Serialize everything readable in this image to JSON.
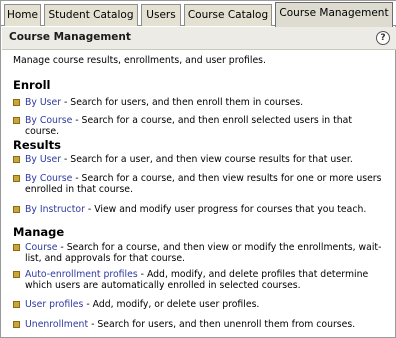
{
  "tabs": [
    {
      "label": "Home"
    },
    {
      "label": "Student Catalog"
    },
    {
      "label": "Users"
    },
    {
      "label": "Course Catalog"
    },
    {
      "label": "Course Management"
    }
  ],
  "header": {
    "title": "Course Management",
    "help": "?"
  },
  "intro": "Manage course results, enrollments, and user profiles.",
  "sections": {
    "enroll": {
      "title": "Enroll",
      "items": [
        {
          "link": "By User",
          "desc": " - Search for users, and then enroll them in courses."
        },
        {
          "link": "By Course",
          "desc": " - Search for a course, and then enroll selected users in that course."
        }
      ]
    },
    "results": {
      "title": "Results",
      "items": [
        {
          "link": "By User",
          "desc": " - Search for a user, and then view course results for that user."
        },
        {
          "link": "By Course",
          "desc": " - Search for a course, and then view results for one or more users enrolled in that course."
        },
        {
          "link": "By Instructor",
          "desc": " - View and modify user progress for courses that you teach."
        }
      ]
    },
    "manage": {
      "title": "Manage",
      "items": [
        {
          "link": "Course",
          "desc": " - Search for a course, and then view or modify the enrollments, wait-list, and approvals for that course."
        },
        {
          "link": "Auto-enrollment profiles",
          "desc": " - Add, modify, and delete profiles that determine which users are automatically enrolled in selected courses."
        },
        {
          "link": "User profiles",
          "desc": " - Add, modify, or delete user profiles."
        },
        {
          "link": "Unenrollment",
          "desc": " - Search for users, and then unenroll them from courses."
        }
      ]
    }
  }
}
